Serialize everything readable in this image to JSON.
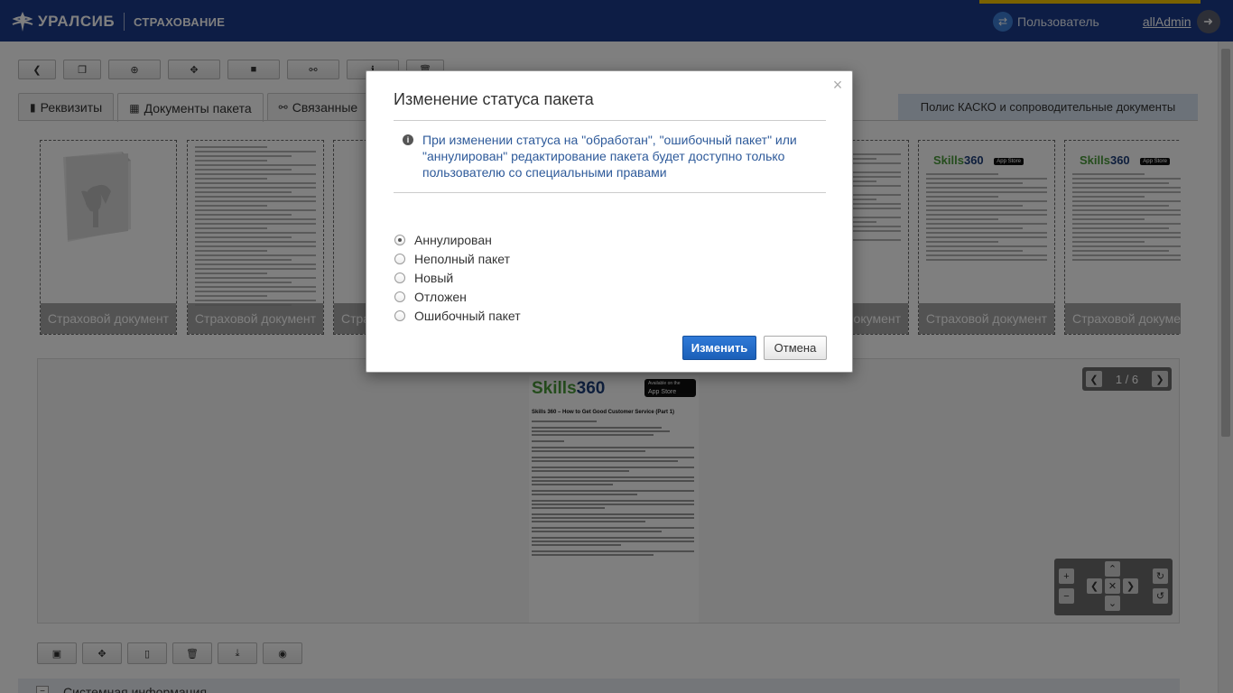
{
  "header": {
    "brand": "УРАЛСИБ",
    "sub": "СТРАХОВАНИЕ",
    "user_label": "Пользователь",
    "admin_name": "allAdmin"
  },
  "toolbar": {
    "icons": [
      "arrow-left-icon",
      "copy-icon",
      "plus-circle-icon",
      "move-icon",
      "folder-icon",
      "link-icon",
      "info-icon",
      "trash-icon"
    ]
  },
  "tabs": [
    {
      "label": "Реквизиты"
    },
    {
      "label": "Документы пакета"
    },
    {
      "label": "Связанные"
    }
  ],
  "policy_badge": "Полис КАСКО и сопроводительные документы",
  "thumbnails": [
    {
      "caption": "Страховой документ"
    },
    {
      "caption": "Страховой документ"
    },
    {
      "caption": "Стра"
    },
    {
      "caption": "окумент"
    },
    {
      "caption": "Страховой документ"
    },
    {
      "caption": "Страховой докуме"
    }
  ],
  "viewer": {
    "skills_logo": "Skills",
    "skills_logo_num": "360",
    "appstore_line1": "Available on the",
    "appstore_line2": "App Store",
    "doc_title": "Skills 360 – How to Get Good Customer Service (Part 1)",
    "pager_text": "1 / 6"
  },
  "modal": {
    "title": "Изменение статуса пакета",
    "close": "×",
    "info": "При изменении статуса на \"обработан\", \"ошибочный пакет\" или \"аннулирован\" редактирование пакета будет доступно только пользователю со специальными правами",
    "options": [
      {
        "label": "Аннулирован",
        "checked": true
      },
      {
        "label": "Неполный пакет",
        "checked": false
      },
      {
        "label": "Новый",
        "checked": false
      },
      {
        "label": "Отложен",
        "checked": false
      },
      {
        "label": "Ошибочный пакет",
        "checked": false
      }
    ],
    "submit": "Изменить",
    "cancel": "Отмена"
  },
  "sysinfo": "Системная информация",
  "colors": {
    "header_bg": "#1b3a8a",
    "accent_yellow": "#f5c400",
    "primary_button": "#1b5fb8"
  }
}
